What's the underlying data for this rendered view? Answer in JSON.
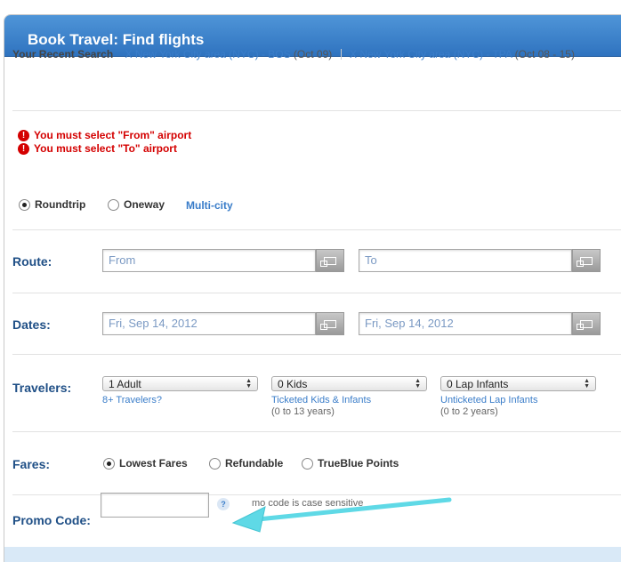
{
  "header": {
    "title": "Book Travel: Find flights"
  },
  "recent": {
    "label": "Your Recent Search",
    "items": [
      {
        "remove": "X",
        "route": "New York City area (NYC) - BOS",
        "dates": "(Oct 09)"
      },
      {
        "remove": "X",
        "route": "New York City area (NYC) - TPA",
        "dates": "(Oct 08 - 15)"
      }
    ]
  },
  "errors": [
    "You must select \"From\" airport",
    "You must select \"To\" airport"
  ],
  "trip_type": {
    "options": [
      "Roundtrip",
      "Oneway"
    ],
    "selected": "Roundtrip",
    "multi_city": "Multi-city"
  },
  "route": {
    "label": "Route:",
    "from_value": "From",
    "to_value": "To"
  },
  "dates": {
    "label": "Dates:",
    "depart": "Fri, Sep 14, 2012",
    "return": "Fri, Sep 14, 2012"
  },
  "travelers": {
    "label": "Travelers:",
    "adults": "1 Adult",
    "kids": "0 Kids",
    "infants": "0 Lap Infants",
    "adults_link": "8+ Travelers?",
    "kids_link": "Ticketed Kids & Infants",
    "kids_note": "(0 to 13 years)",
    "infants_link": "Unticketed Lap Infants",
    "infants_note": "(0 to 2 years)"
  },
  "fares": {
    "label": "Fares:",
    "options": [
      "Lowest Fares",
      "Refundable",
      "TrueBlue Points"
    ],
    "selected": "Lowest Fares"
  },
  "promo": {
    "label": "Promo Code:",
    "value": "",
    "help": "?",
    "note": "mo code is case sensitive"
  },
  "colors": {
    "header": "#2f73bf",
    "link": "#3a7dc9",
    "error": "#d40000",
    "label": "#1f4f86",
    "annotation_arrow": "#5fd9e6"
  }
}
